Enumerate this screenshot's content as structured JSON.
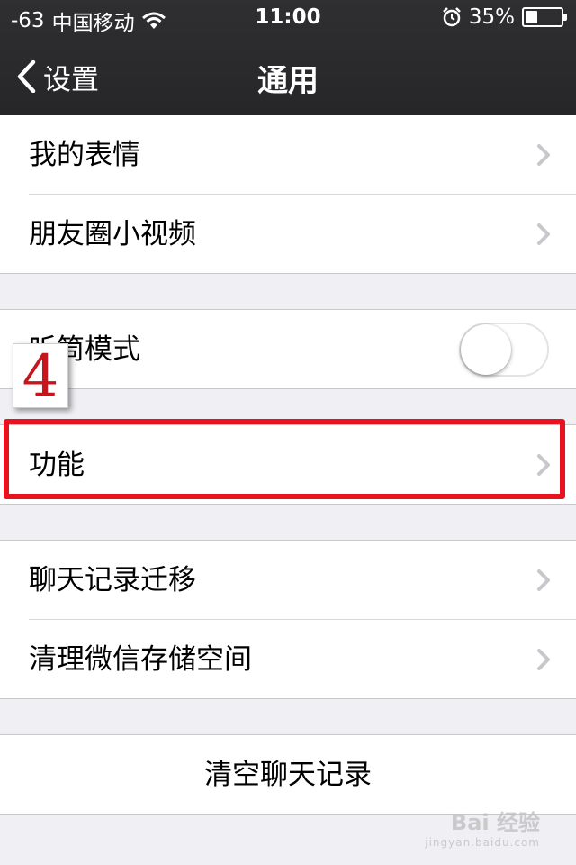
{
  "status_bar": {
    "signal": "-63",
    "carrier": "中国移动",
    "time": "11:00",
    "battery": "35%",
    "battery_level": 0.35
  },
  "nav": {
    "back_label": "设置",
    "title": "通用"
  },
  "sections": {
    "s1": [
      "我的表情",
      "朋友圈小视频"
    ],
    "s2": {
      "label": "听筒模式",
      "toggle_on": false
    },
    "s3": "功能",
    "s4": [
      "聊天记录迁移",
      "清理微信存储空间"
    ],
    "s5": "清空聊天记录"
  },
  "annotation": {
    "step": "4",
    "highlight_color": "#e8131f"
  },
  "watermark": {
    "brand": "Bai 经验",
    "url": "jingyan.baidu.com"
  },
  "icons": [
    "wifi-icon",
    "alarm-icon",
    "battery-icon",
    "chevron-left-icon",
    "chevron-right-icon"
  ]
}
